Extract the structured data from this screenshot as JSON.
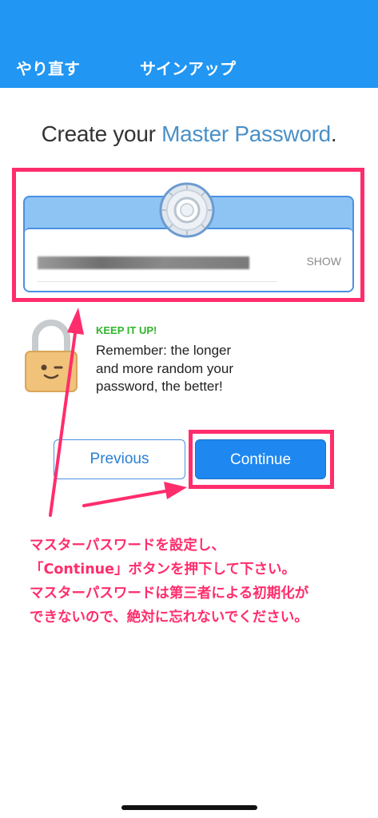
{
  "topbar": {
    "retry_label": "やり直す",
    "signup_label": "サインアップ",
    "background": "#2196f3"
  },
  "title": {
    "prefix": "Create your ",
    "accent": "Master Password",
    "suffix": "."
  },
  "password_field": {
    "value": "●●●●●●●●●●●●●●●●",
    "show_label": "SHOW"
  },
  "strength": {
    "status": "KEEP IT UP!",
    "message": "Remember: the longer and more random your password, the better!"
  },
  "buttons": {
    "previous": "Previous",
    "continue": "Continue"
  },
  "annotation": {
    "line1": "マスターパスワードを設定し、",
    "line2": "「Continue」ボタンを押下して下さい。",
    "line3": "マスターパスワードは第三者による初期化が",
    "line4": "できないので、絶対に忘れないでください。",
    "color": "#ff2d6c"
  }
}
